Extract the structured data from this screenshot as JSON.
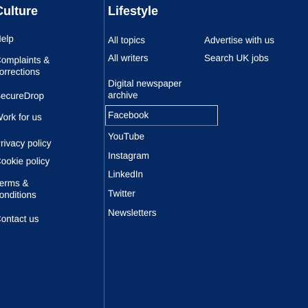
{
  "columns": {
    "culture": {
      "heading": "Culture",
      "items": [
        "Help",
        "Complaints &\ncorrections",
        "SecureDrop",
        "Work for us",
        "Privacy policy",
        "Cookie policy",
        "Terms &\nconditions",
        "Contact us"
      ]
    },
    "lifestyle": {
      "heading": "Lifestyle",
      "items": [
        "All topics",
        "All writers",
        "Digital newspaper\narchive",
        "Facebook",
        "YouTube",
        "Instagram",
        "LinkedIn",
        "Twitter",
        "Newsletters"
      ]
    },
    "commercial": {
      "items": [
        "Advertise with us",
        "Search UK jobs"
      ]
    }
  },
  "colors": {
    "background": "#052962",
    "text": "#ffffff",
    "divider": "#506991"
  }
}
